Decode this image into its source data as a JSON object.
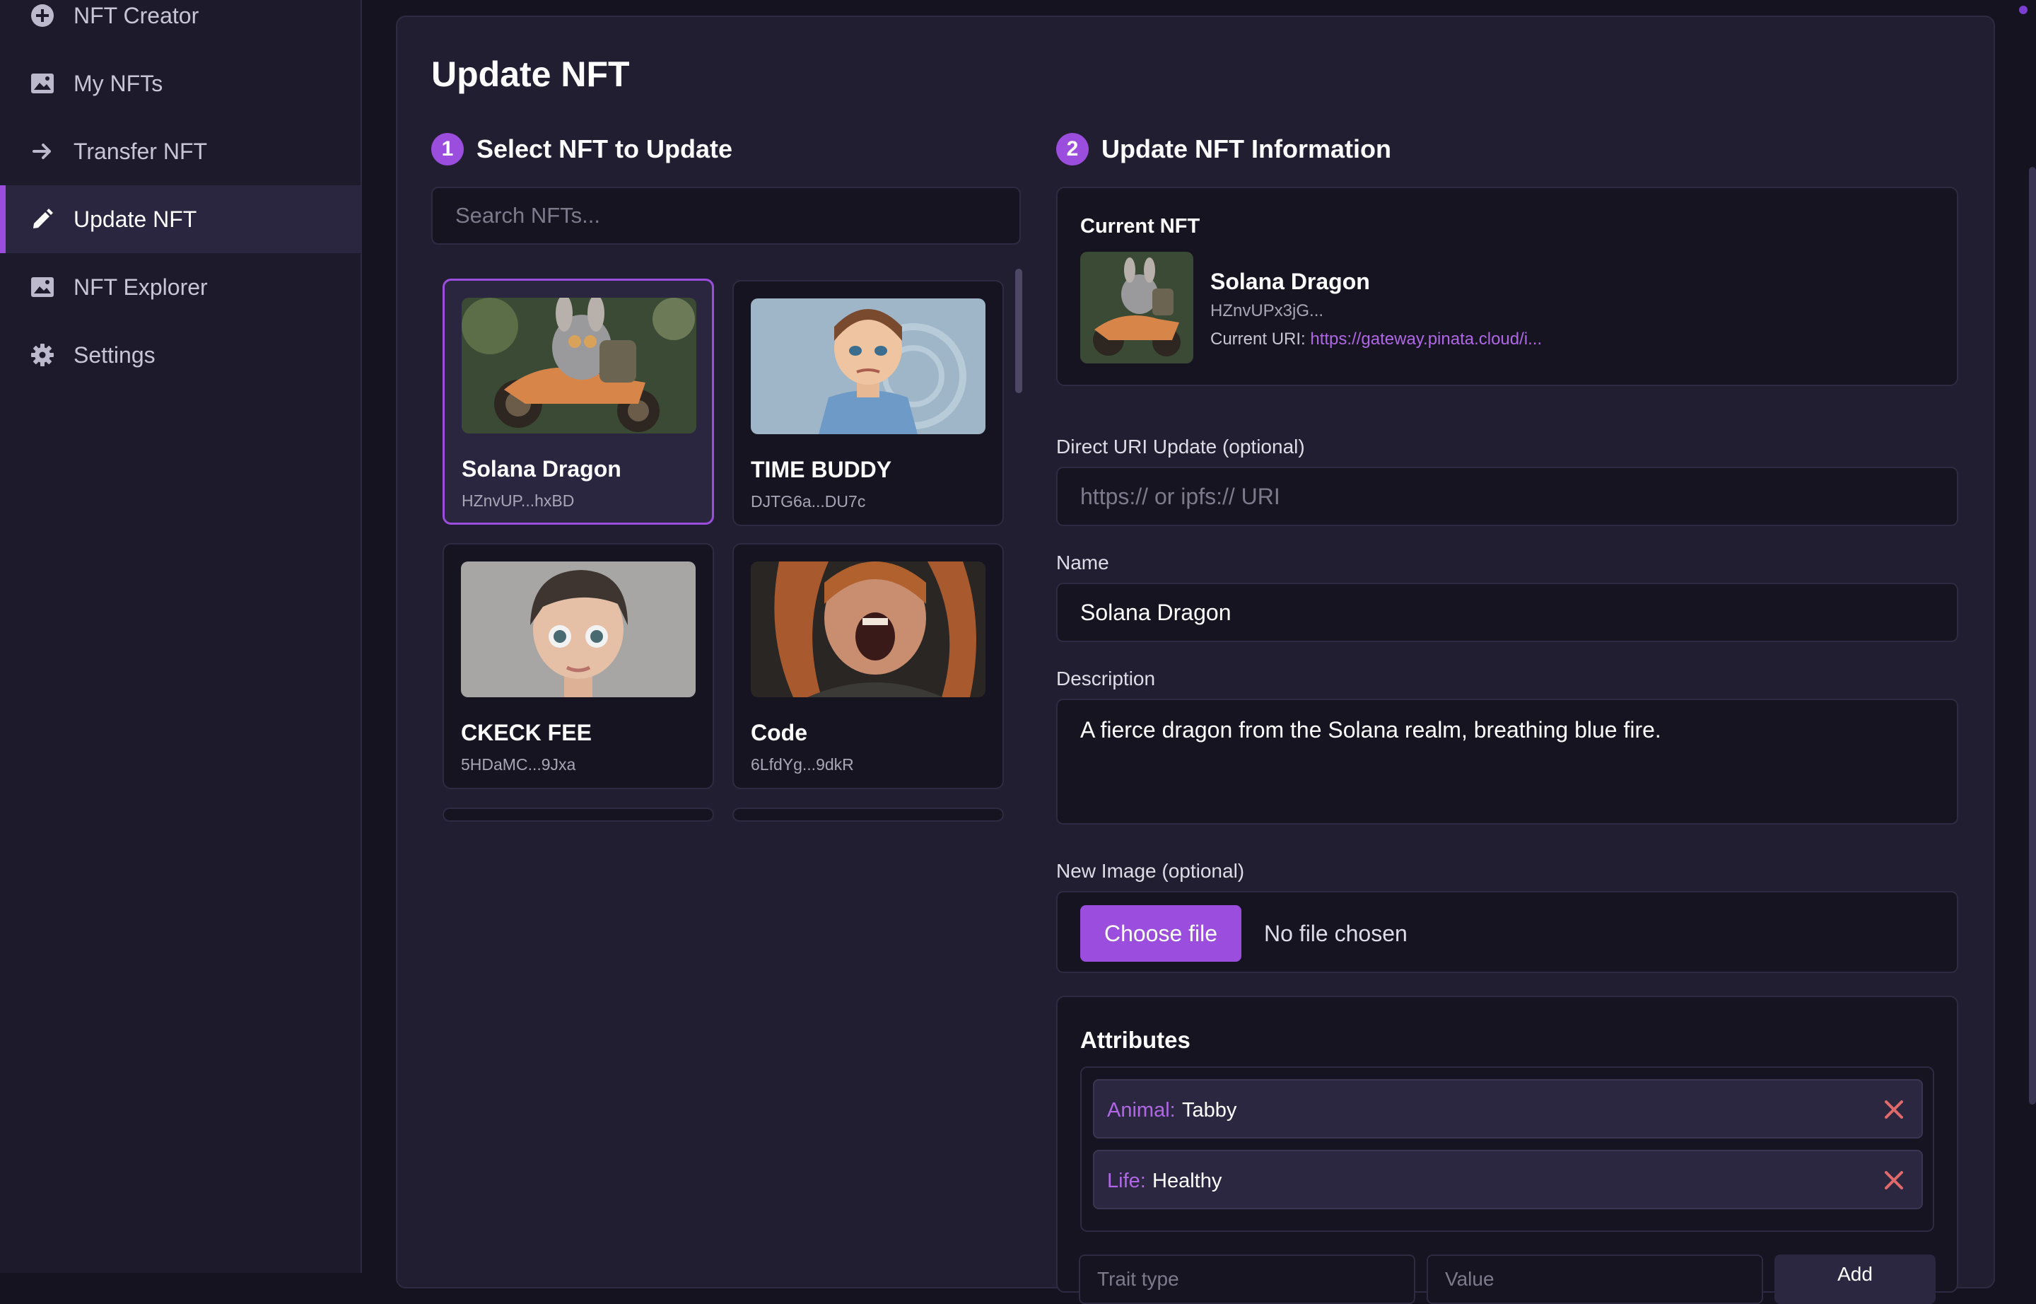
{
  "sidebar": {
    "items": [
      {
        "label": "NFT Creator",
        "icon": "plus-circle-icon"
      },
      {
        "label": "My NFTs",
        "icon": "image-icon"
      },
      {
        "label": "Transfer NFT",
        "icon": "arrow-right-icon"
      },
      {
        "label": "Update NFT",
        "icon": "pencil-icon"
      },
      {
        "label": "NFT Explorer",
        "icon": "image-icon"
      },
      {
        "label": "Settings",
        "icon": "gear-icon"
      }
    ],
    "active": "Update NFT"
  },
  "page": {
    "title": "Update NFT",
    "step1": {
      "number": "1",
      "title": "Select NFT to Update"
    },
    "step2": {
      "number": "2",
      "title": "Update NFT Information"
    }
  },
  "search": {
    "placeholder": "Search NFTs..."
  },
  "nfts": [
    {
      "name": "Solana Dragon",
      "address": "HZnvUP...hxBD",
      "selected": true
    },
    {
      "name": "TIME BUDDY",
      "address": "DJTG6a...DU7c"
    },
    {
      "name": "CKECK FEE",
      "address": "5HDaMC...9Jxa"
    },
    {
      "name": "Code",
      "address": "6LfdYg...9dkR"
    }
  ],
  "current": {
    "heading": "Current NFT",
    "name": "Solana Dragon",
    "address": "HZnvUPx3jG...",
    "uri_label": "Current URI:",
    "uri_value": "https://gateway.pinata.cloud/i..."
  },
  "form": {
    "uri_label": "Direct URI Update (optional)",
    "uri_placeholder": "https:// or ipfs:// URI",
    "name_label": "Name",
    "name_value": "Solana Dragon",
    "description_label": "Description",
    "description_value": "A fierce dragon from the Solana realm, breathing blue fire.",
    "image_label": "New Image (optional)",
    "choose_file": "Choose file",
    "file_status": "No file chosen"
  },
  "attributes": {
    "title": "Attributes",
    "items": [
      {
        "trait": "Animal:",
        "value": "Tabby"
      },
      {
        "trait": "Life:",
        "value": "Healthy"
      }
    ],
    "trait_placeholder": "Trait type",
    "value_placeholder": "Value",
    "add_label": "Add"
  },
  "colors": {
    "accent": "#9b4dde",
    "background": "#15131f",
    "panel": "#221e31",
    "remove": "#e06a6a"
  }
}
